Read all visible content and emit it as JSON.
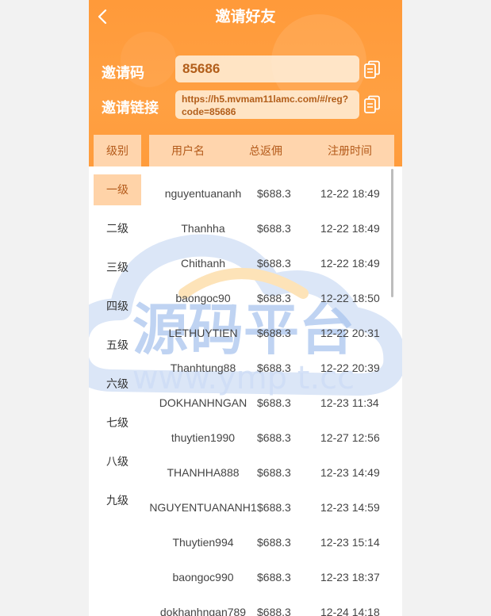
{
  "header": {
    "title": "邀请好友",
    "code_label": "邀请码",
    "code_value": "85686",
    "link_label": "邀请链接",
    "link_value": "https://h5.mvmam11lamc.com/#/reg?code=85686"
  },
  "table": {
    "level_header": "级别",
    "col_user": "用户名",
    "col_amount": "总返佣",
    "col_time": "注册时间"
  },
  "levels": [
    "一级",
    "二级",
    "三级",
    "四级",
    "五级",
    "六级",
    "七级",
    "八级",
    "九级"
  ],
  "rows": [
    {
      "user": "nguyentuananh",
      "amount": "$688.3",
      "time": "12-22 18:49"
    },
    {
      "user": "Thanhha",
      "amount": "$688.3",
      "time": "12-22 18:49"
    },
    {
      "user": "Chithanh",
      "amount": "$688.3",
      "time": "12-22 18:49"
    },
    {
      "user": "baongoc90",
      "amount": "$688.3",
      "time": "12-22 18:50"
    },
    {
      "user": "LETHUYTIEN",
      "amount": "$688.3",
      "time": "12-22 20:31"
    },
    {
      "user": "Thanhtung88",
      "amount": "$688.3",
      "time": "12-22 20:39"
    },
    {
      "user": "DOKHANHNGAN",
      "amount": "$688.3",
      "time": "12-23 11:34"
    },
    {
      "user": "thuytien1990",
      "amount": "$688.3",
      "time": "12-27 12:56"
    },
    {
      "user": "THANHHA888",
      "amount": "$688.3",
      "time": "12-23 14:49"
    },
    {
      "user": "NGUYENTUANANH1",
      "amount": "$688.3",
      "time": "12-23 14:59"
    },
    {
      "user": "Thuytien994",
      "amount": "$688.3",
      "time": "12-23 15:14"
    },
    {
      "user": "baongoc990",
      "amount": "$688.3",
      "time": "12-23 18:37"
    },
    {
      "user": "dokhanhngan789",
      "amount": "$688.3",
      "time": "12-24 14:18"
    }
  ],
  "watermark": {
    "main": "源码平台",
    "sub": "www.ymp t.cc"
  },
  "colors": {
    "accent": "#ffa042",
    "tab_bg": "#ffd5ad",
    "accent_text": "#b45b1b"
  }
}
